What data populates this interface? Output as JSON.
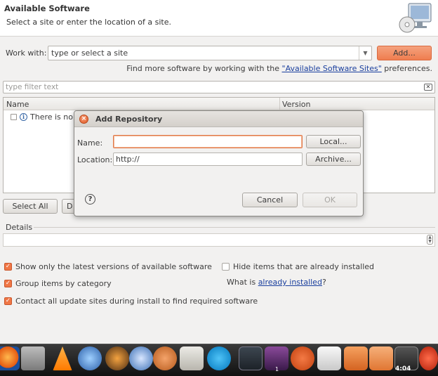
{
  "header": {
    "title": "Available Software",
    "subtitle": "Select a site or enter the location of a site."
  },
  "work_with": {
    "label": "Work with:",
    "combo_value": "type or select a site",
    "add_button": "Add...",
    "find_more_prefix": "Find more software by working with the ",
    "find_more_link": "\"Available Software Sites\"",
    "find_more_suffix": " preferences."
  },
  "filter": {
    "placeholder": "type filter text"
  },
  "table": {
    "columns": [
      "Name",
      "Version"
    ],
    "rows": [
      {
        "name": "There is no s"
      }
    ]
  },
  "buttons": {
    "select_all": "Select All",
    "deselect_all_partial": "D"
  },
  "details": {
    "label": "Details"
  },
  "options": {
    "latest_versions": "Show only the latest versions of available software",
    "hide_installed": "Hide items that are already installed",
    "group_by_category": "Group items by category",
    "what_is_prefix": "What is ",
    "already_installed_link": "already installed",
    "what_is_suffix": "?",
    "contact_sites": "Contact all update sites during install to find required software"
  },
  "option_states": {
    "latest_versions": true,
    "hide_installed": false,
    "group_by_category": true,
    "contact_sites": true
  },
  "dialog": {
    "title": "Add Repository",
    "name_label": "Name:",
    "name_value": "",
    "location_label": "Location:",
    "location_value": "http://",
    "local_button": "Local...",
    "archive_button": "Archive...",
    "cancel_button": "Cancel",
    "ok_button": "OK"
  },
  "taskbar": {
    "clock": "4:04",
    "workspace_badge": "1",
    "icons": [
      "firefox-icon",
      "calculator-icon",
      "vlc-icon",
      "thunderbird-icon",
      "game-icon",
      "disc-icon",
      "pidgin-icon",
      "nautilus-icon",
      "skype-icon",
      "terminal-icon",
      "workspace-icon",
      "ubuntu-icon",
      "text-editor-icon",
      "files-icon",
      "download-icon",
      "media-icon",
      "power-icon"
    ]
  },
  "colors": {
    "accent": "#f07746",
    "link": "#1a3f9e",
    "background": "#f2f1f0"
  }
}
